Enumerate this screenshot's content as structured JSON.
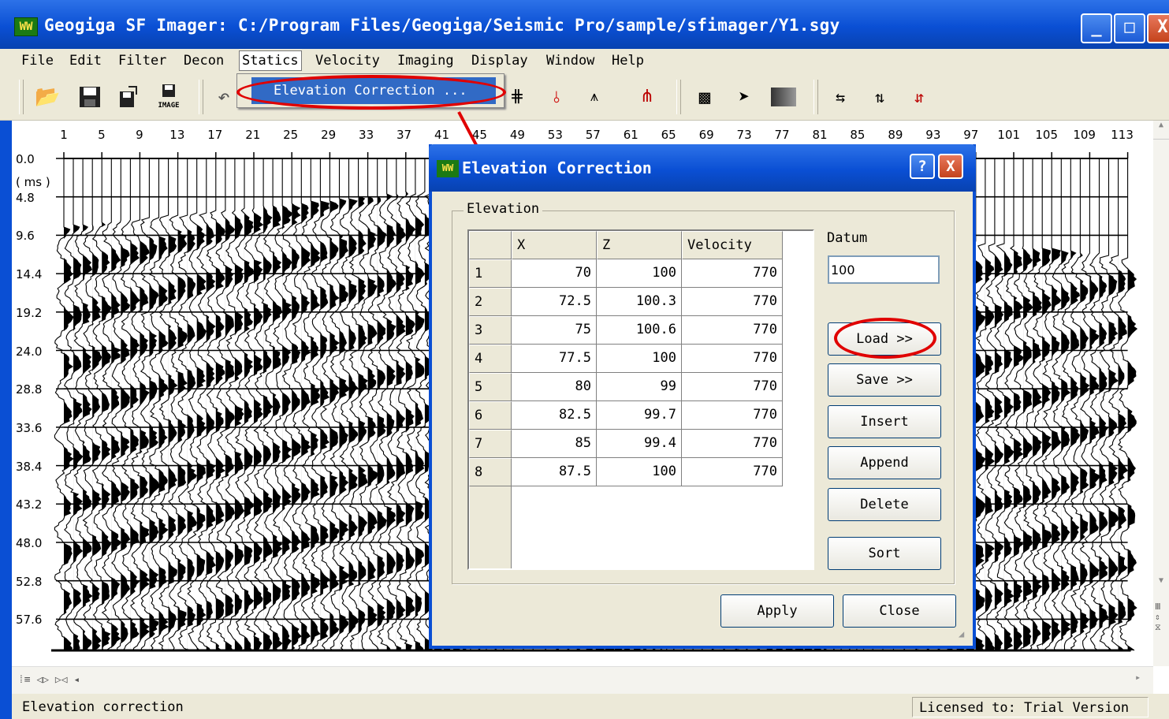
{
  "app": {
    "title": "Geogiga SF Imager: C:/Program Files/Geogiga/Seismic Pro/sample/sfimager/Y1.sgy",
    "logo": "WW",
    "window_buttons": [
      "_",
      "□",
      "X"
    ]
  },
  "menubar": {
    "items": [
      "File",
      "Edit",
      "Filter",
      "Decon",
      "Statics",
      "Velocity",
      "Imaging",
      "Display",
      "Window",
      "Help"
    ],
    "open_menu": "Statics",
    "dropdown_item": "Elevation Correction ..."
  },
  "toolbar": {
    "icons": [
      "open-folder-icon",
      "save-icon",
      "save-as-icon",
      "save-image-icon",
      "undo-icon",
      "filter-icon",
      "decon-icon",
      "trace-pick-icon",
      "spike-icon",
      "wiggle-icon",
      "density-icon",
      "ray-icon",
      "gray-map-icon",
      "shift-left-icon",
      "shift-both-icon",
      "shift-right-icon"
    ],
    "image_label": "IMAGE"
  },
  "plot": {
    "x_ticks": [
      "1",
      "5",
      "9",
      "13",
      "17",
      "21",
      "25",
      "29",
      "33",
      "37",
      "41",
      "45",
      "49",
      "53",
      "57",
      "61",
      "65",
      "69",
      "73",
      "77",
      "81",
      "85",
      "89",
      "93",
      "97",
      "101",
      "105",
      "109",
      "113"
    ],
    "y_ticks": [
      "0.0",
      "4.8",
      "9.6",
      "14.4",
      "19.2",
      "24.0",
      "28.8",
      "33.6",
      "38.4",
      "43.2",
      "48.0",
      "52.8",
      "57.6"
    ],
    "y_unit": "( ms )"
  },
  "status": {
    "left": "Elevation correction",
    "right": "Licensed to: Trial Version"
  },
  "dialog": {
    "title": "Elevation Correction",
    "help_glyph": "?",
    "close_glyph": "X",
    "group_label": "Elevation",
    "columns": [
      "X",
      "Z",
      "Velocity"
    ],
    "rows": [
      {
        "n": "1",
        "x": "70",
        "z": "100",
        "v": "770"
      },
      {
        "n": "2",
        "x": "72.5",
        "z": "100.3",
        "v": "770"
      },
      {
        "n": "3",
        "x": "75",
        "z": "100.6",
        "v": "770"
      },
      {
        "n": "4",
        "x": "77.5",
        "z": "100",
        "v": "770"
      },
      {
        "n": "5",
        "x": "80",
        "z": "99",
        "v": "770"
      },
      {
        "n": "6",
        "x": "82.5",
        "z": "99.7",
        "v": "770"
      },
      {
        "n": "7",
        "x": "85",
        "z": "99.4",
        "v": "770"
      },
      {
        "n": "8",
        "x": "87.5",
        "z": "100",
        "v": "770"
      }
    ],
    "datum_label": "Datum",
    "datum_value": "100",
    "buttons": {
      "load": "Load >>",
      "save": "Save >>",
      "insert": "Insert",
      "append": "Append",
      "delete": "Delete",
      "sort": "Sort",
      "apply": "Apply",
      "close": "Close"
    }
  },
  "colors": {
    "titlebar": "#0a4fd4",
    "highlight": "#316ac5",
    "annotation": "#e00000"
  }
}
